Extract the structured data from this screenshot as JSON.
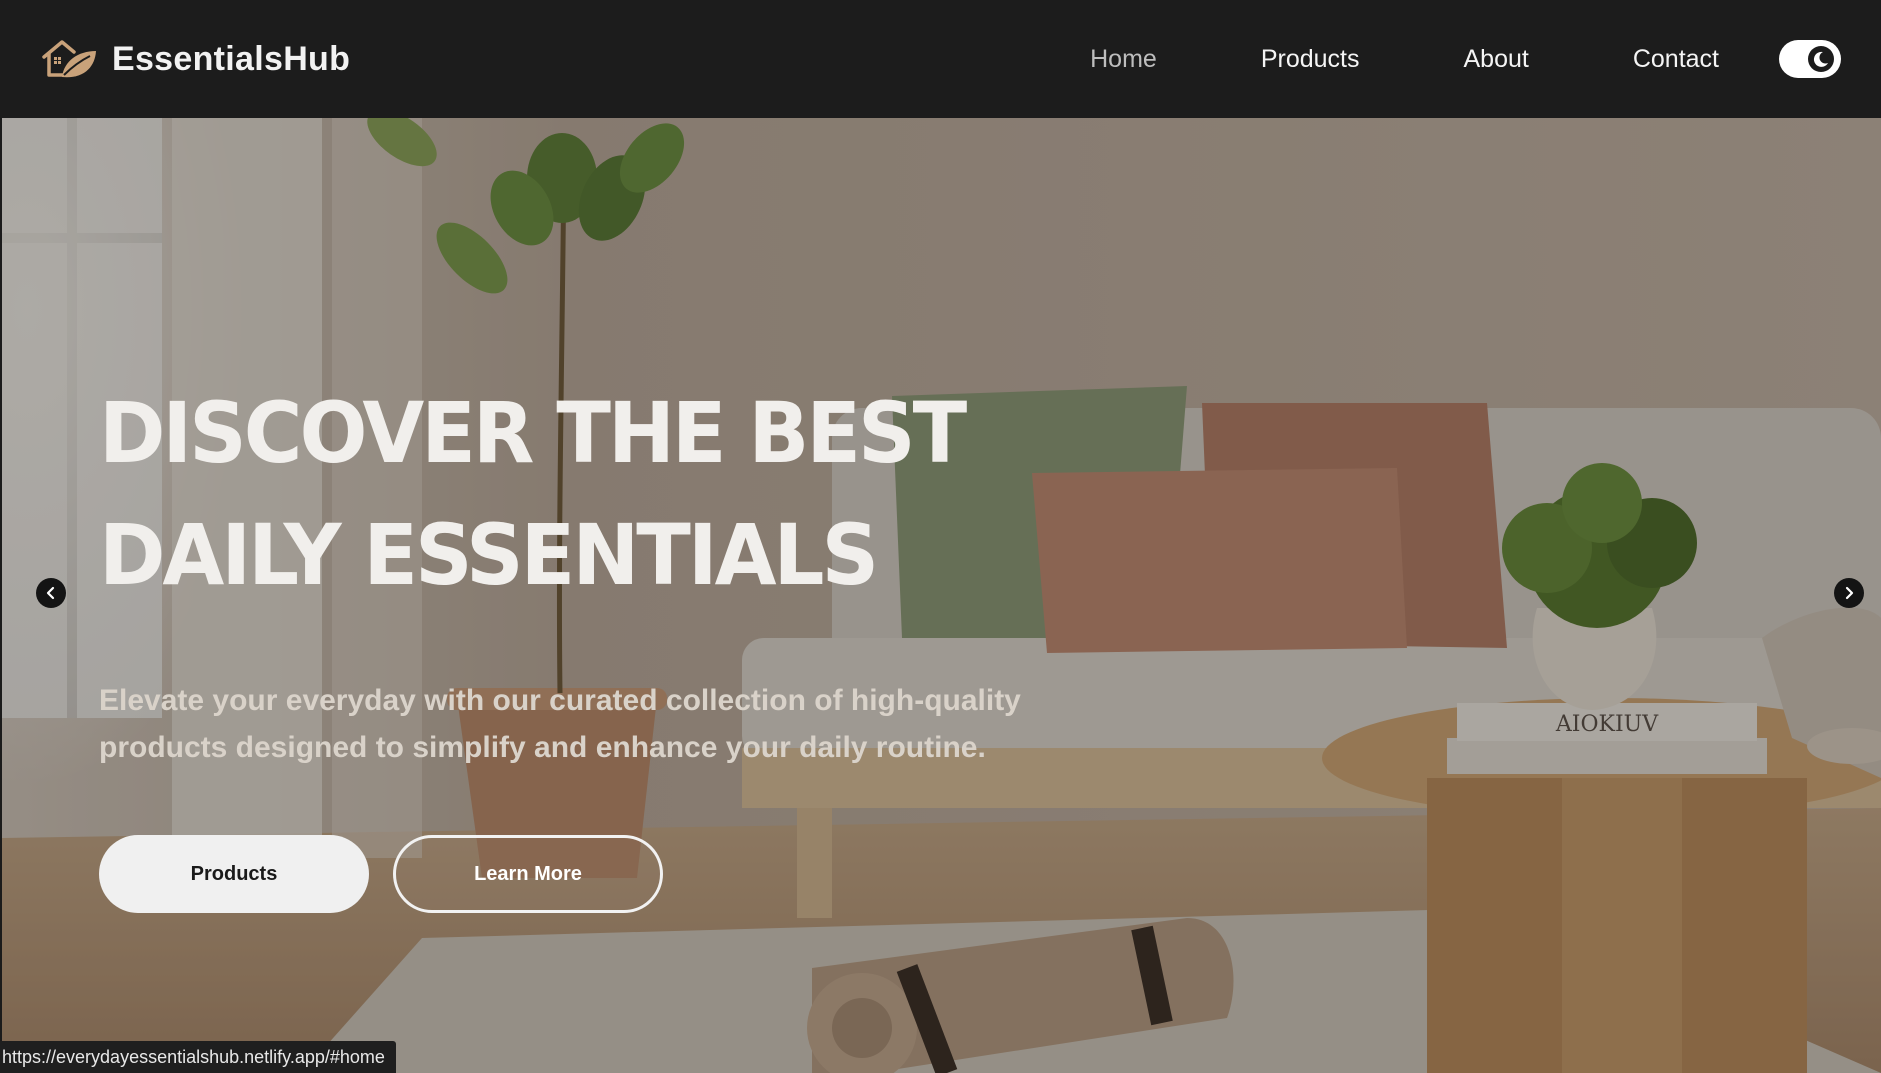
{
  "navbar": {
    "brand_name": "EssentialsHub",
    "logo_icon": "house-leaf-icon",
    "links": [
      "Home",
      "Products",
      "About",
      "Contact"
    ],
    "active_link": "Home",
    "theme_toggle_icon": "moon-icon"
  },
  "hero": {
    "title_line1": "DISCOVER THE BEST",
    "title_line2": "DAILY ESSENTIALS",
    "subtitle": "Elevate your everyday with our curated collection of high-quality products designed to simplify and enhance your daily routine.",
    "primary_button": "Products",
    "secondary_button": "Learn More",
    "prev_icon": "chevron-left-icon",
    "next_icon": "chevron-right-icon",
    "book_spine_text": "AIOKIUV"
  },
  "status_bar": {
    "url": "https://everydayessentialshub.netlify.app/#home"
  },
  "colors": {
    "navbar_bg": "#1c1c1c",
    "text_light": "#f2f2f2",
    "nav_active": "#bdbdbd",
    "logo_accent": "#c9a27a"
  }
}
